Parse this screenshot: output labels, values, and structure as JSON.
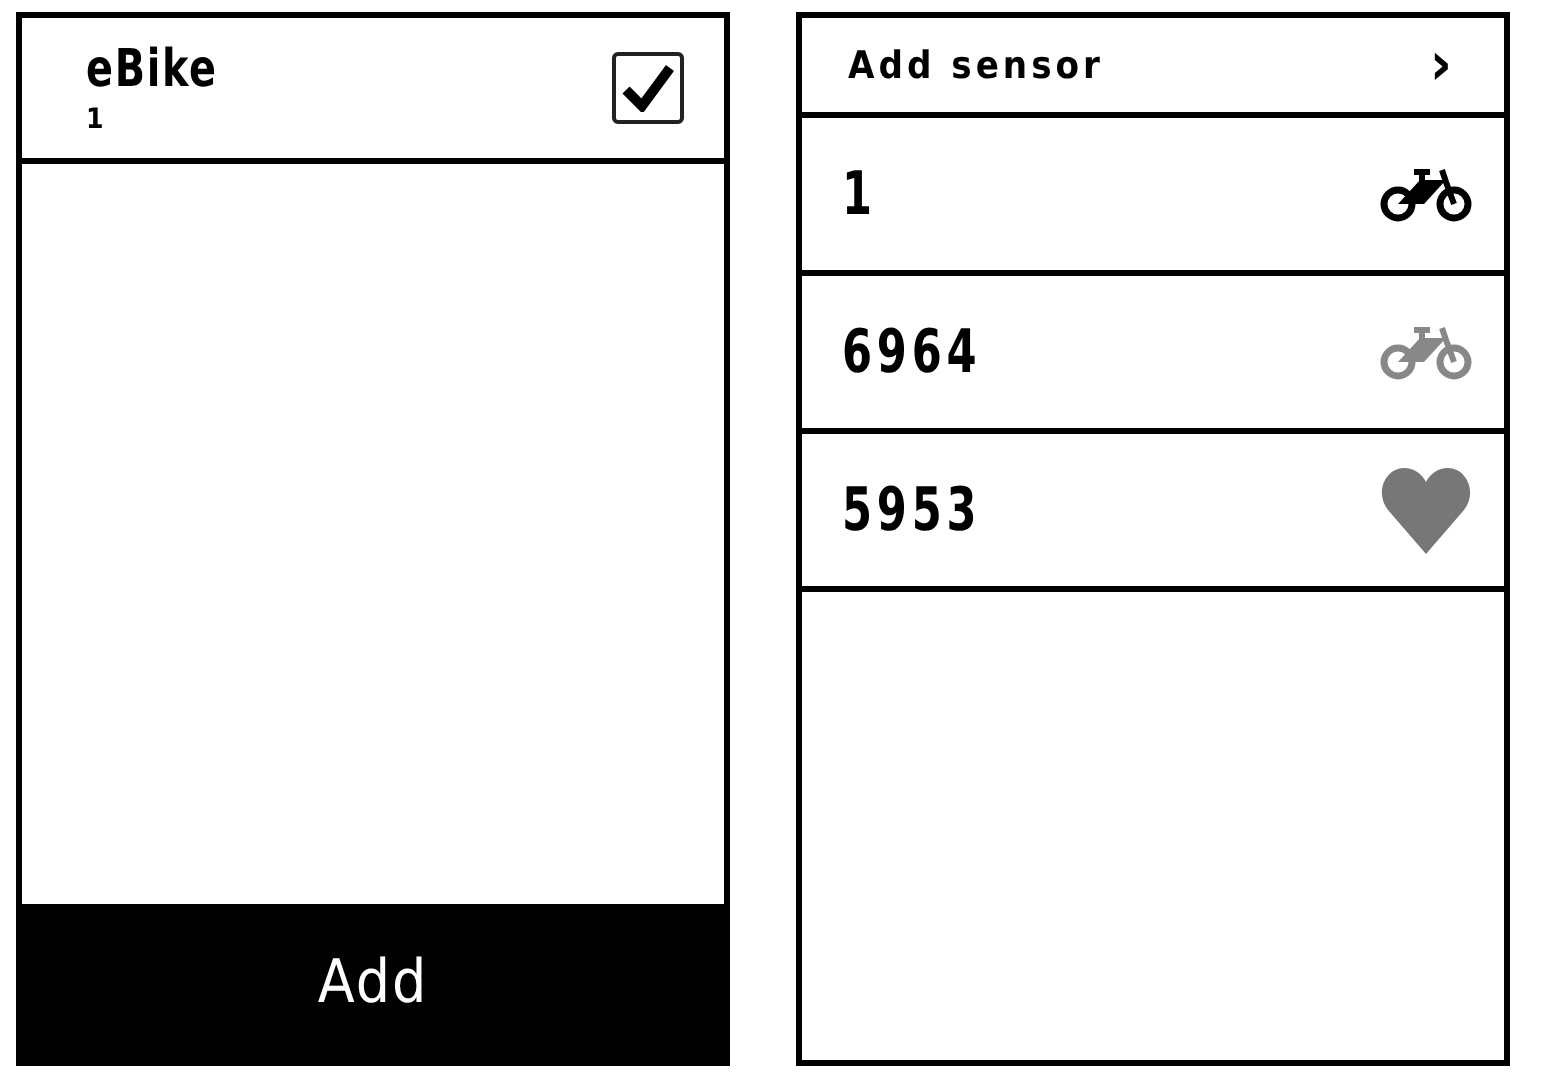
{
  "bike_screen": {
    "title": "eBike",
    "subtitle": "1",
    "checked": true,
    "button": "Add"
  },
  "sensor_screen": {
    "title": "Add sensor",
    "arrow": "›",
    "sensors": [
      {
        "name": "1",
        "kind": "bike",
        "connected": true
      },
      {
        "name": "6964",
        "kind": "bike",
        "connected": false
      },
      {
        "name": "5953",
        "kind": "heart",
        "connected": false
      }
    ]
  }
}
